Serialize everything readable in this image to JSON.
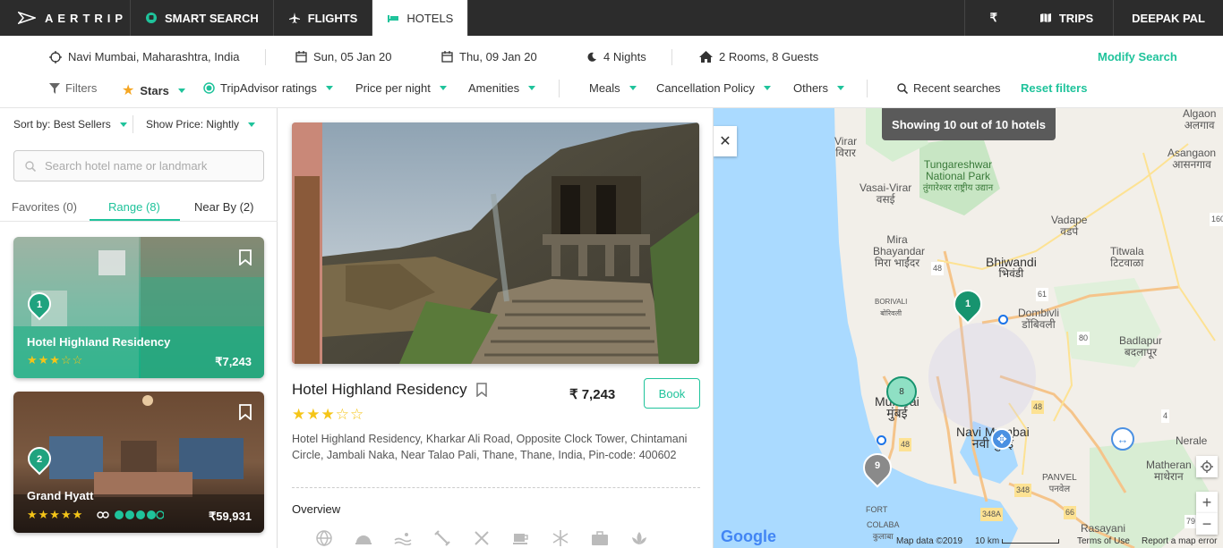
{
  "nav": {
    "logo": "AERTRIP",
    "smart_search": "SMART SEARCH",
    "flights": "FLIGHTS",
    "hotels": "HOTELS",
    "currency": "₹",
    "trips": "TRIPS",
    "user": "DEEPAK PAL"
  },
  "search": {
    "location": "Navi Mumbai, Maharashtra, India",
    "checkin": "Sun, 05 Jan 20",
    "checkout": "Thu, 09 Jan 20",
    "nights": "4 Nights",
    "guests": "2 Rooms, 8 Guests",
    "modify": "Modify Search"
  },
  "filters": {
    "filters": "Filters",
    "stars": "Stars",
    "tripadvisor": "TripAdvisor ratings",
    "price": "Price per night",
    "amenities": "Amenities",
    "meals": "Meals",
    "cancellation": "Cancellation Policy",
    "others": "Others",
    "recent": "Recent searches",
    "reset": "Reset filters"
  },
  "list": {
    "sort_label": "Sort by:",
    "sort_value": "Best Sellers",
    "show_label": "Show Price:",
    "show_value": "Nightly",
    "search_placeholder": "Search hotel name or landmark",
    "tabs": [
      {
        "label": "Favorites",
        "count": "(0)"
      },
      {
        "label": "Range",
        "count": "(8)"
      },
      {
        "label": "Near By",
        "count": "(2)"
      }
    ],
    "hotels": [
      {
        "pin": "1",
        "name": "Hotel Highland Residency",
        "stars": "★★★☆☆",
        "price": "₹7,243"
      },
      {
        "pin": "2",
        "name": "Grand Hyatt",
        "stars": "★★★★★",
        "price": "₹59,931"
      }
    ]
  },
  "detail": {
    "name": "Hotel Highland Residency",
    "stars": "★★★☆☆",
    "price": "₹ 7,243",
    "book": "Book",
    "address": "Hotel Highland Residency, Kharkar Ali Road, Opposite Clock Tower, Chintamani Circle, Jambali Naka, Near Talao Pali, Thane, Thane, India, Pin-code: 400602",
    "overview": "Overview",
    "amenities": [
      "globe-icon",
      "cloche-icon",
      "pool-icon",
      "gym-icon",
      "restaurant-icon",
      "coffee-icon",
      "ac-icon",
      "business-icon",
      "spa-icon"
    ]
  },
  "map": {
    "showing": "Showing 10 out of 10 hotels",
    "labels": {
      "virar": "Virar",
      "virar_hi": "विरार",
      "tungareshwar": "Tungareshwar National Park",
      "tungareshwar_hi": "तुंगारेश्वर राष्ट्रीय उद्यान",
      "vasai": "Vasai-Virar",
      "vasai_hi": "वसई",
      "mira": "Mira Bhayandar",
      "mira_hi": "मिरा भाईंदर",
      "bhiwandi": "Bhiwandi",
      "bhiwandi_hi": "भिवंडी",
      "dombivli": "Dombivli",
      "dombivli_hi": "डोंबिवली",
      "badlapur": "Badlapur",
      "badlapur_hi": "बदलापूर",
      "titwala": "Titwala",
      "titwala_hi": "टिटवाळा",
      "asangaon": "Asangaon",
      "asangaon_hi": "आसनगाव",
      "vadape": "Vadape",
      "vadape_hi": "वडपे",
      "algaon": "Algaon",
      "algaon_hi": "अलगाव",
      "mumbai": "Mumbai",
      "mumbai_hi": "मुंबई",
      "navi_mumbai": "Navi Mumbai",
      "navi_mumbai_hi": "नवी मुंबई",
      "panvel": "PANVEL",
      "panvel_hi": "पनवेल",
      "matheran": "Matheran",
      "matheran_hi": "माथेरान",
      "nerale": "Nerale",
      "rasayani": "Rasayani",
      "borivali": "BORIVALI",
      "borivali_hi": "बोरिवली",
      "colaba": "COLABA",
      "colaba_hi": "कुलाबा",
      "fort": "FORT",
      "r48a": "48",
      "r48b": "48",
      "r48c": "48",
      "r61": "61",
      "r80a": "80",
      "r80b": "80",
      "r4": "4",
      "r348": "348",
      "r348a": "348A",
      "r66": "66",
      "r79": "79",
      "r160": "160"
    },
    "pins": [
      "1",
      "8",
      "9"
    ],
    "brand": "Google",
    "map_data": "Map data ©2019",
    "scale": "10 km",
    "terms": "Terms of Use",
    "report": "Report a map error"
  }
}
